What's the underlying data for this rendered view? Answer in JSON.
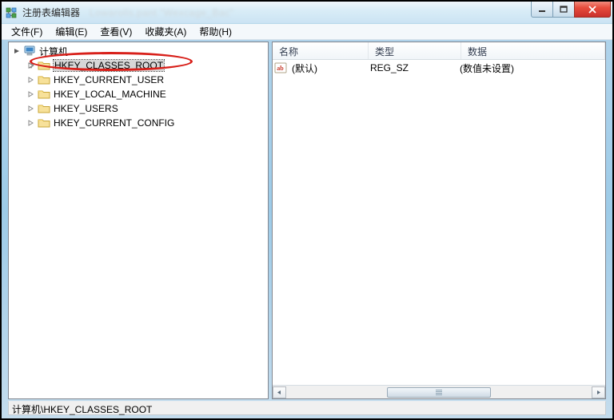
{
  "titlebar": {
    "title": "注册表编辑器",
    "blurred_extra": "Lowarolls.pant \"Wexcage_Bac\""
  },
  "menubar": {
    "items": [
      {
        "label": "文件(F)"
      },
      {
        "label": "编辑(E)"
      },
      {
        "label": "查看(V)"
      },
      {
        "label": "收藏夹(A)"
      },
      {
        "label": "帮助(H)"
      }
    ]
  },
  "tree": {
    "root": {
      "label": "计算机",
      "expanded": true
    },
    "hives": [
      {
        "label": "HKEY_CLASSES_ROOT",
        "selected": true
      },
      {
        "label": "HKEY_CURRENT_USER"
      },
      {
        "label": "HKEY_LOCAL_MACHINE"
      },
      {
        "label": "HKEY_USERS"
      },
      {
        "label": "HKEY_CURRENT_CONFIG"
      }
    ]
  },
  "list": {
    "columns": {
      "name": "名称",
      "type": "类型",
      "data": "数据"
    },
    "rows": [
      {
        "name": "(默认)",
        "type": "REG_SZ",
        "data": "(数值未设置)"
      }
    ]
  },
  "statusbar": {
    "path": "计算机\\HKEY_CLASSES_ROOT"
  }
}
